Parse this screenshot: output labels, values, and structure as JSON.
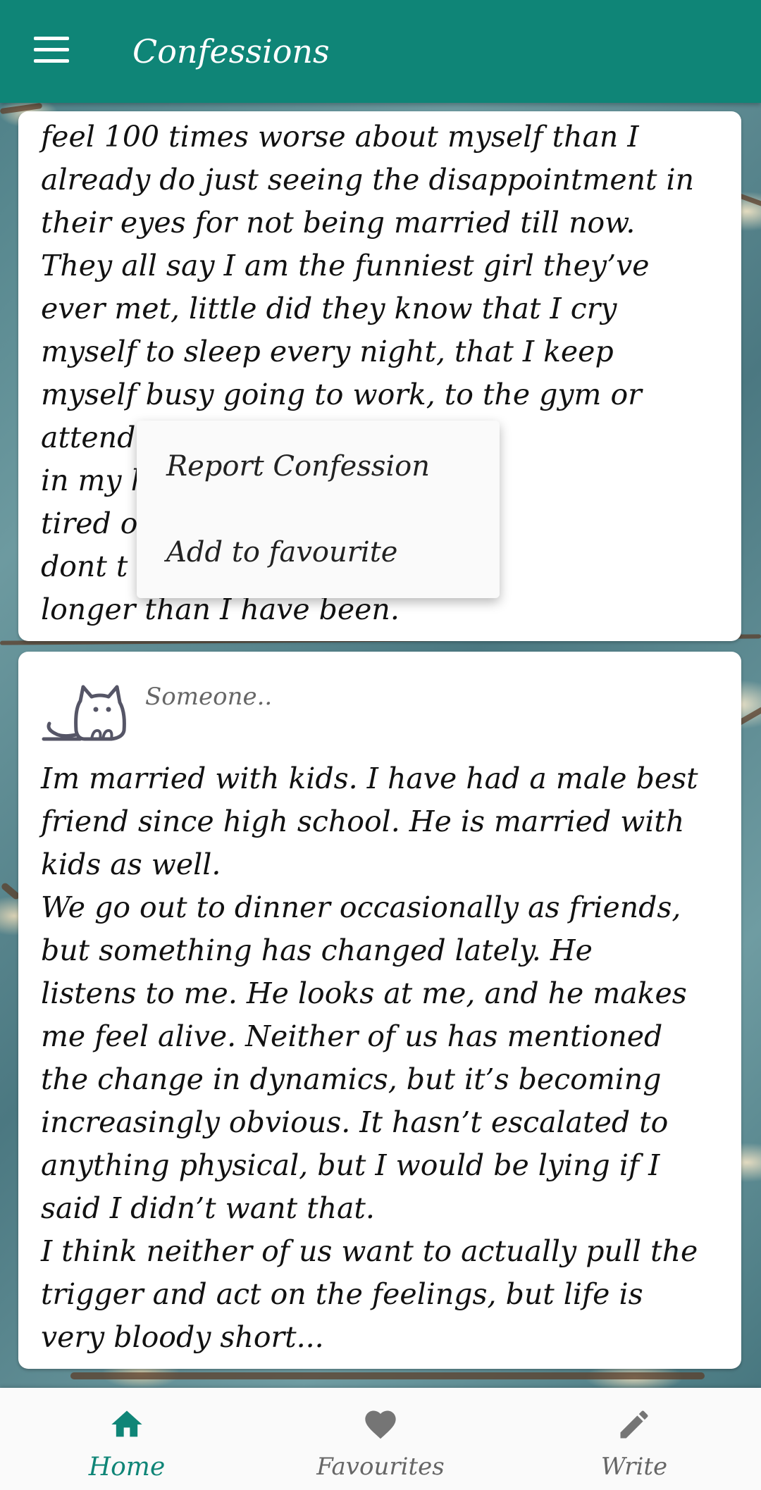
{
  "app": {
    "title": "Confessions"
  },
  "cards": [
    {
      "text": "feel 100 times worse about myself than I\nalready do just seeing the disappointment in\ntheir eyes for not being married till now.\nThey all say I am the funniest girl they’ve\never met, little did they know that I cry\nmyself to sleep every night, that I keep\nmyself busy going to work, to the gym or\nattend                                        t the voices\nin my h                                        ikes you. I am\ntired o                                        really tired. I\ndont t                                        p going on for\nlonger than I have been."
    },
    {
      "author": "Someone..",
      "text": "Im married with kids. I have had a male best\nfriend since high school. He is married with\nkids as well.\nWe go out to dinner occasionally as friends,\nbut something has changed lately. He\nlistens to me. He looks at me, and he makes\nme feel alive. Neither of us has mentioned\nthe change in dynamics, but it’s becoming\nincreasingly obvious. It hasn’t escalated to\nanything physical, but I would be lying if I\nsaid I didn’t want that.\nI think neither of us want to actually pull the\ntrigger and act on the feelings, but life is\nvery bloody short..."
    }
  ],
  "popup_menu": {
    "items": [
      "Report Confession",
      "Add to favourite"
    ]
  },
  "bottom_nav": {
    "items": [
      {
        "label": "Home",
        "icon": "home-icon",
        "active": true
      },
      {
        "label": "Favourites",
        "icon": "heart-icon",
        "active": false
      },
      {
        "label": "Write",
        "icon": "pencil-icon",
        "active": false
      }
    ]
  },
  "colors": {
    "primary": "#0f8577",
    "inactive": "#666666",
    "card": "#ffffff"
  }
}
